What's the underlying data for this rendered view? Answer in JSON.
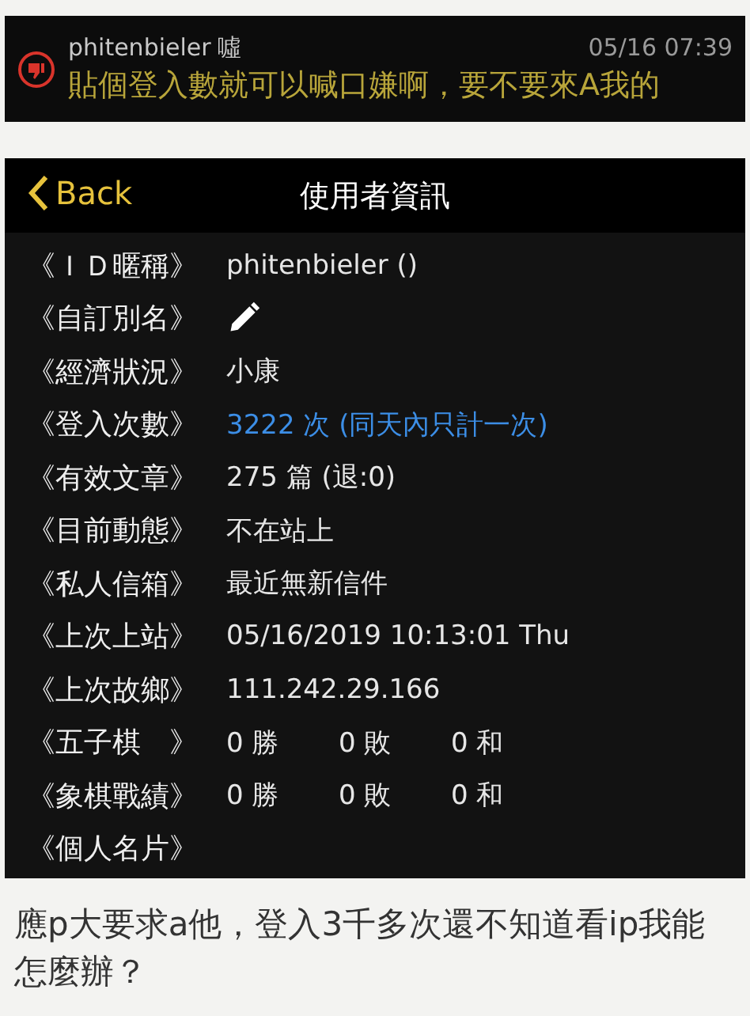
{
  "comment": {
    "author": "phitenbieler",
    "tag": "噓",
    "time": "05/16 07:39",
    "text": "貼個登入數就可以喊口嫌啊，要不要來A我的"
  },
  "header": {
    "back": "Back",
    "title": "使用者資訊"
  },
  "rows": [
    {
      "label": "《ＩＤ暱稱》",
      "kind": "text",
      "value": "phitenbieler ()"
    },
    {
      "label": "《自訂別名》",
      "kind": "edit"
    },
    {
      "label": "《經濟狀況》",
      "kind": "text",
      "value": "小康"
    },
    {
      "label": "《登入次數》",
      "kind": "link",
      "value": "3222 次 (同天內只計一次)"
    },
    {
      "label": "《有效文章》",
      "kind": "text",
      "value": "275 篇 (退:0)"
    },
    {
      "label": "《目前動態》",
      "kind": "text",
      "value": "不在站上"
    },
    {
      "label": "《私人信箱》",
      "kind": "text",
      "value": "最近無新信件"
    },
    {
      "label": "《上次上站》",
      "kind": "text",
      "value": "05/16/2019 10:13:01 Thu"
    },
    {
      "label": "《上次故鄉》",
      "kind": "text",
      "value": "111.242.29.166"
    },
    {
      "label": "《五子棋　》",
      "kind": "record",
      "values": [
        "0 勝",
        "0 敗",
        "0 和"
      ]
    },
    {
      "label": "《象棋戰績》",
      "kind": "record",
      "values": [
        "0 勝",
        "0 敗",
        "0 和"
      ]
    },
    {
      "label": "《個人名片》",
      "kind": "none"
    }
  ],
  "caption": "應p大要求a他，登入3千多次還不知道看ip我能怎麼辦？"
}
